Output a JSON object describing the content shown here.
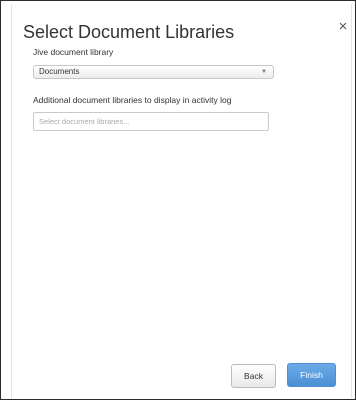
{
  "dialog": {
    "title": "Select Document Libraries",
    "close_icon": "close-icon",
    "close_glyph": "×"
  },
  "library": {
    "label": "Jive document library",
    "selected_value": "Documents",
    "arrow_glyph": "▼"
  },
  "additional": {
    "label": "Additional document libraries to display in activity log",
    "placeholder": "Select document libraries..."
  },
  "buttons": {
    "back_label": "Back",
    "finish_label": "Finish"
  },
  "colors": {
    "primary_button": "#5a9ce0",
    "border": "#2b2b2b"
  }
}
